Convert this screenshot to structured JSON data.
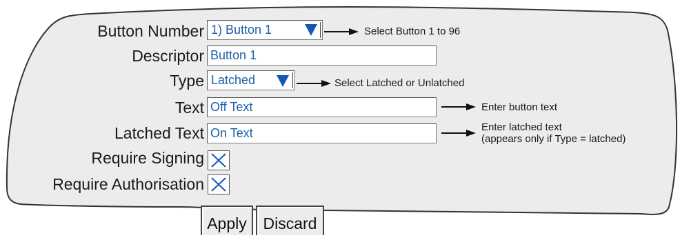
{
  "form": {
    "button_number": {
      "label": "Button Number",
      "value": "1) Button 1",
      "note": "Select Button 1 to 96"
    },
    "descriptor": {
      "label": "Descriptor",
      "value": "Button 1"
    },
    "type": {
      "label": "Type",
      "value": "Latched",
      "note": "Select Latched or Unlatched"
    },
    "text": {
      "label": "Text",
      "value": "Off Text",
      "note": "Enter button text"
    },
    "latched_text": {
      "label": "Latched Text",
      "value": "On Text",
      "note_line1": "Enter latched text",
      "note_line2": "(appears only if Type = latched)"
    },
    "require_signing": {
      "label": "Require Signing",
      "checked": true
    },
    "require_authorisation": {
      "label": "Require Authorisation",
      "checked": true
    }
  },
  "actions": {
    "apply_label": "Apply",
    "discard_label": "Discard"
  },
  "colors": {
    "value_text": "#1a5fa8",
    "dropdown_arrow": "#1556b8",
    "panel_bg": "#ececec",
    "outline": "#333333"
  },
  "icons": {
    "dropdown": "triangle-down-icon",
    "checkbox": "x-mark-icon",
    "annotation": "right-arrow-icon"
  }
}
